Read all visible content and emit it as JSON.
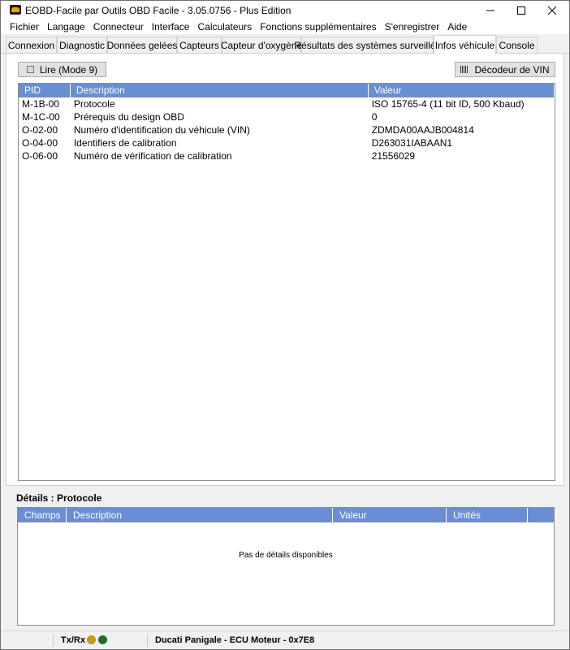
{
  "window": {
    "title": "EOBD-Facile par Outils OBD Facile - 3.05.0756 - Plus Edition",
    "app_icon": "eobd-car-icon",
    "controls": [
      "minimize-icon",
      "maximize-icon",
      "close-icon"
    ]
  },
  "menu": [
    "Fichier",
    "Langage",
    "Connecteur",
    "Interface",
    "Calculateurs",
    "Fonctions supplémentaires",
    "S'enregistrer",
    "Aide"
  ],
  "tabs": {
    "items": [
      "Connexion",
      "Diagnostic",
      "Données gelées",
      "Capteurs",
      "Capteur d'oxygène",
      "Résultats des systèmes surveillés",
      "Infos véhicule",
      "Console"
    ],
    "active": "Infos véhicule"
  },
  "toolbar": {
    "read_label": "Lire (Mode 9)",
    "vin_decoder_label": "Décodeur de VIN"
  },
  "info_table": {
    "columns": [
      "PID",
      "Description",
      "Valeur"
    ],
    "rows": [
      {
        "pid": "M-1B-00",
        "description": "Protocole",
        "value": "ISO 15765-4 (11 bit ID, 500 Kbaud)"
      },
      {
        "pid": "M-1C-00",
        "description": "Prérequis du design OBD",
        "value": "0"
      },
      {
        "pid": "O-02-00",
        "description": "Numéro d'identification du véhicule (VIN)",
        "value": "ZDMDA00AAJB004814"
      },
      {
        "pid": "O-04-00",
        "description": "Identifiers de calibration",
        "value": "D263031IABAAN1"
      },
      {
        "pid": "O-06-00",
        "description": "Numéro de vérification de calibration",
        "value": "21556029"
      }
    ]
  },
  "details": {
    "label": "Détails : Protocole",
    "columns": [
      "Champs",
      "Description",
      "Valeur",
      "Unités"
    ],
    "empty_text": "Pas de détails disponibles"
  },
  "status": {
    "txrx_label": "Tx/Rx",
    "tx_color": "#c49b12",
    "rx_color": "#1f6f2a",
    "vehicle": "Ducati Panigale - ECU Moteur - 0x7E8"
  },
  "colors": {
    "header_blue": "#6a8ed4"
  }
}
